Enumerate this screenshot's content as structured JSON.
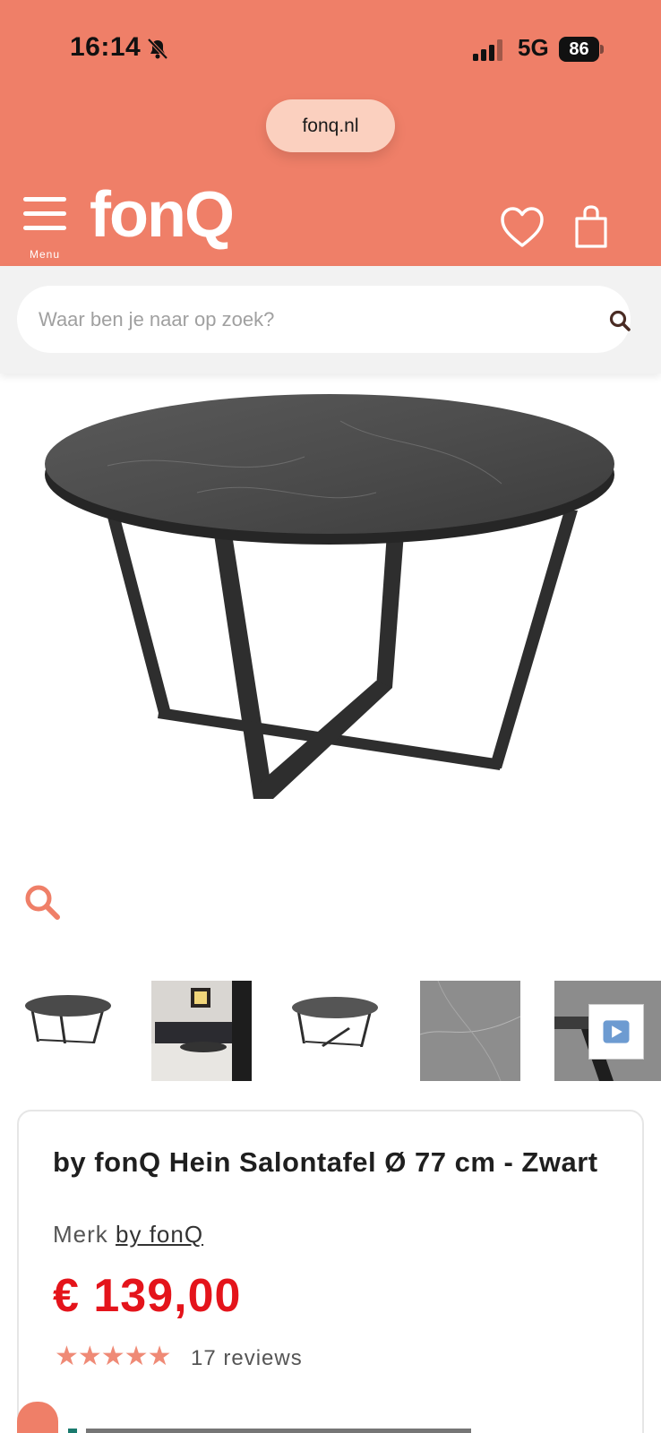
{
  "status_bar": {
    "time": "16:14",
    "network": "5G",
    "battery": "86"
  },
  "browser": {
    "url": "fonq.nl"
  },
  "header": {
    "menu_label": "Menu",
    "logo": "fonQ"
  },
  "search": {
    "placeholder": "Waar ben je naar op zoek?"
  },
  "product": {
    "title": "by fonQ Hein Salontafel Ø 77 cm - Zwart",
    "brand_prefix": "Merk",
    "brand": "by fonQ",
    "price": "€ 139,00",
    "rating_stars": 5,
    "reviews": "17 reviews"
  },
  "colors": {
    "brand": "#ef7f68",
    "price": "#e4141b",
    "stars": "#ef8a76"
  },
  "icons": [
    "bell-off-icon",
    "signal-icon",
    "battery-icon",
    "menu-icon",
    "heart-icon",
    "bag-icon",
    "search-icon",
    "zoom-icon",
    "video-play-icon"
  ]
}
